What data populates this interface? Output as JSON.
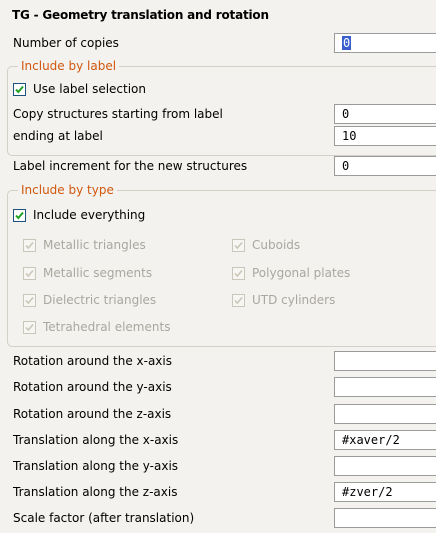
{
  "title": "TG - Geometry translation and rotation",
  "copies": {
    "label": "Number of copies",
    "value": "0"
  },
  "include_by_label": {
    "group_title": "Include by label",
    "use_label_selection": "Use label selection",
    "copy_start_label": "Copy structures starting from label",
    "copy_start_value": "0",
    "ending_label": "ending at label",
    "ending_value": "10"
  },
  "label_increment": {
    "label": "Label increment for the new structures",
    "value": "0"
  },
  "include_by_type": {
    "group_title": "Include by type",
    "include_everything": "Include everything",
    "types_left": [
      "Metallic triangles",
      "Metallic segments",
      "Dielectric triangles",
      "Tetrahedral elements"
    ],
    "types_right": [
      "Cuboids",
      "Polygonal plates",
      "UTD cylinders"
    ]
  },
  "transforms": [
    {
      "label": "Rotation around the x-axis",
      "value": ""
    },
    {
      "label": "Rotation around the y-axis",
      "value": ""
    },
    {
      "label": "Rotation around the z-axis",
      "value": ""
    },
    {
      "label": "Translation along the x-axis",
      "value": "#xaver/2"
    },
    {
      "label": "Translation along the y-axis",
      "value": ""
    },
    {
      "label": "Translation along the z-axis",
      "value": "#zver/2"
    },
    {
      "label": "Scale factor (after translation)",
      "value": ""
    }
  ],
  "colors": {
    "group_title": "#d1570f",
    "check": "#21a121",
    "selection": "#3a5fcd"
  }
}
